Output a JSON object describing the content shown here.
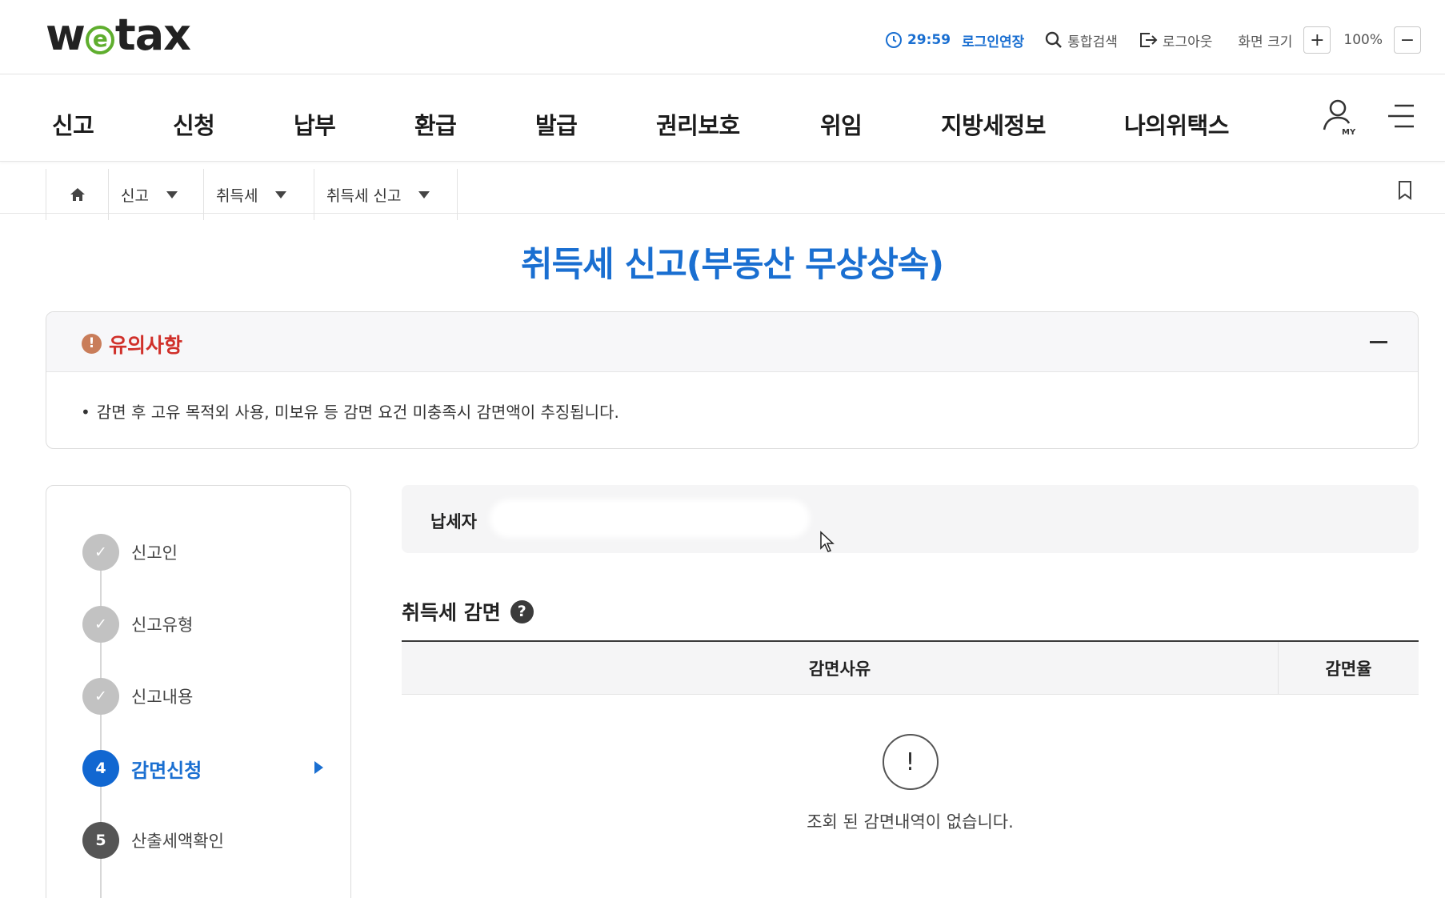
{
  "header": {
    "logo_text": "wetax",
    "session_timer": "29:59",
    "extend_login": "로그인연장",
    "search": "통합검색",
    "logout": "로그아웃",
    "zoom_label": "화면 크기",
    "zoom_plus": "+",
    "zoom_value": "100%",
    "zoom_minus": "−"
  },
  "nav": {
    "items": [
      "신고",
      "신청",
      "납부",
      "환급",
      "발급",
      "권리보호",
      "위임",
      "지방세정보",
      "나의위택스"
    ],
    "my_label": "MY"
  },
  "breadcrumb": [
    "신고",
    "취득세",
    "취득세 신고"
  ],
  "page_title": "취득세 신고(부동산 무상상속)",
  "notice": {
    "title": "유의사항",
    "icon_text": "!",
    "body": "감면 후 고유 목적외 사용, 미보유 등 감면 요건 미충족시 감면액이 추징됩니다."
  },
  "steps": [
    {
      "label": "신고인",
      "state": "done",
      "mark": "✓"
    },
    {
      "label": "신고유형",
      "state": "done",
      "mark": "✓"
    },
    {
      "label": "신고내용",
      "state": "done",
      "mark": "✓"
    },
    {
      "label": "감면신청",
      "state": "active",
      "mark": "4"
    },
    {
      "label": "산출세액확인",
      "state": "todo",
      "mark": "5"
    }
  ],
  "taxpayer_label": "납세자",
  "section": {
    "title": "취득세 감면",
    "help": "?"
  },
  "table": {
    "columns": [
      "감면사유",
      "감면율"
    ],
    "empty_icon": "!",
    "empty_message": "조회 된 감면내역이 없습니다."
  },
  "colors": {
    "accent": "#1a6fd1",
    "notice_title": "#d0302a",
    "logo_green": "#5fae2e"
  }
}
